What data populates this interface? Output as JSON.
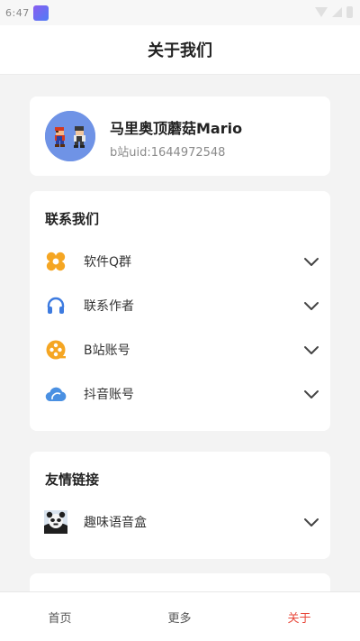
{
  "status_bar": {
    "time": "6:47",
    "app_icon": "app-notification-icon"
  },
  "nav": {
    "title": "关于我们"
  },
  "profile": {
    "name": "马里奥顶蘑菇Mario",
    "uid": "b站uid:1644972548",
    "avatar_icon": "mario-avatar-icon"
  },
  "contact": {
    "title": "联系我们",
    "items": [
      {
        "label": "软件Q群",
        "icon": "grid-icon",
        "color": "#f5a623"
      },
      {
        "label": "联系作者",
        "icon": "headphones-icon",
        "color": "#3d7be0"
      },
      {
        "label": "B站账号",
        "icon": "film-reel-icon",
        "color": "#f5a623"
      },
      {
        "label": "抖音账号",
        "icon": "cloud-icon",
        "color": "#4a90e2"
      }
    ]
  },
  "links": {
    "title": "友情链接",
    "items": [
      {
        "label": "趣味语音盒",
        "icon": "panda-avatar-icon"
      }
    ]
  },
  "tabs": [
    {
      "label": "首页",
      "active": false
    },
    {
      "label": "更多",
      "active": false
    },
    {
      "label": "关于",
      "active": true
    }
  ],
  "colors": {
    "accent": "#e8483b",
    "background": "#f3f3f3",
    "card": "#ffffff"
  }
}
